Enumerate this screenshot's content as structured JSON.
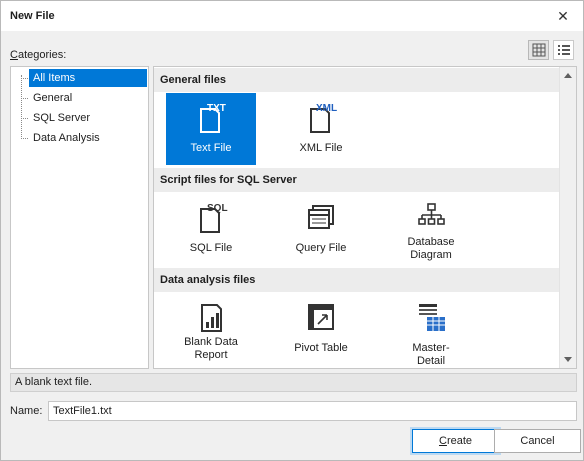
{
  "window": {
    "title": "New File",
    "close_glyph": "✕"
  },
  "categories_label": "Categories:",
  "view_buttons": {
    "large_icon": "large-icons-icon",
    "list_icon": "list-view-icon"
  },
  "tree": {
    "items": [
      {
        "label": "All Items",
        "selected": true
      },
      {
        "label": "General"
      },
      {
        "label": "SQL Server"
      },
      {
        "label": "Data Analysis"
      }
    ]
  },
  "groups": [
    {
      "title": "General files",
      "items": [
        {
          "label": "Text File",
          "icon": "text-file-icon",
          "selected": true
        },
        {
          "label": "XML File",
          "icon": "xml-file-icon"
        }
      ]
    },
    {
      "title": "Script files for SQL Server",
      "items": [
        {
          "label": "SQL File",
          "icon": "sql-file-icon"
        },
        {
          "label": "Query File",
          "icon": "query-file-icon"
        },
        {
          "label": "Database Diagram",
          "icon": "database-diagram-icon"
        }
      ]
    },
    {
      "title": "Data analysis files",
      "items": [
        {
          "label": "Blank Data Report",
          "icon": "data-report-icon"
        },
        {
          "label": "Pivot Table",
          "icon": "pivot-table-icon"
        },
        {
          "label": "Master-Detail",
          "icon": "master-detail-icon"
        }
      ]
    }
  ],
  "icon_text": {
    "txt": "TXT",
    "xml": "XML",
    "sql": "SQL"
  },
  "description": "A blank text file.",
  "name_field": {
    "label": "Name:",
    "value": "TextFile1.txt"
  },
  "buttons": {
    "create_first": "C",
    "create_rest": "reate",
    "cancel": "Cancel"
  },
  "colors": {
    "accent": "#0078d7",
    "xml_blue": "#1f5fbf",
    "grid_blue": "#2a6fc9"
  }
}
